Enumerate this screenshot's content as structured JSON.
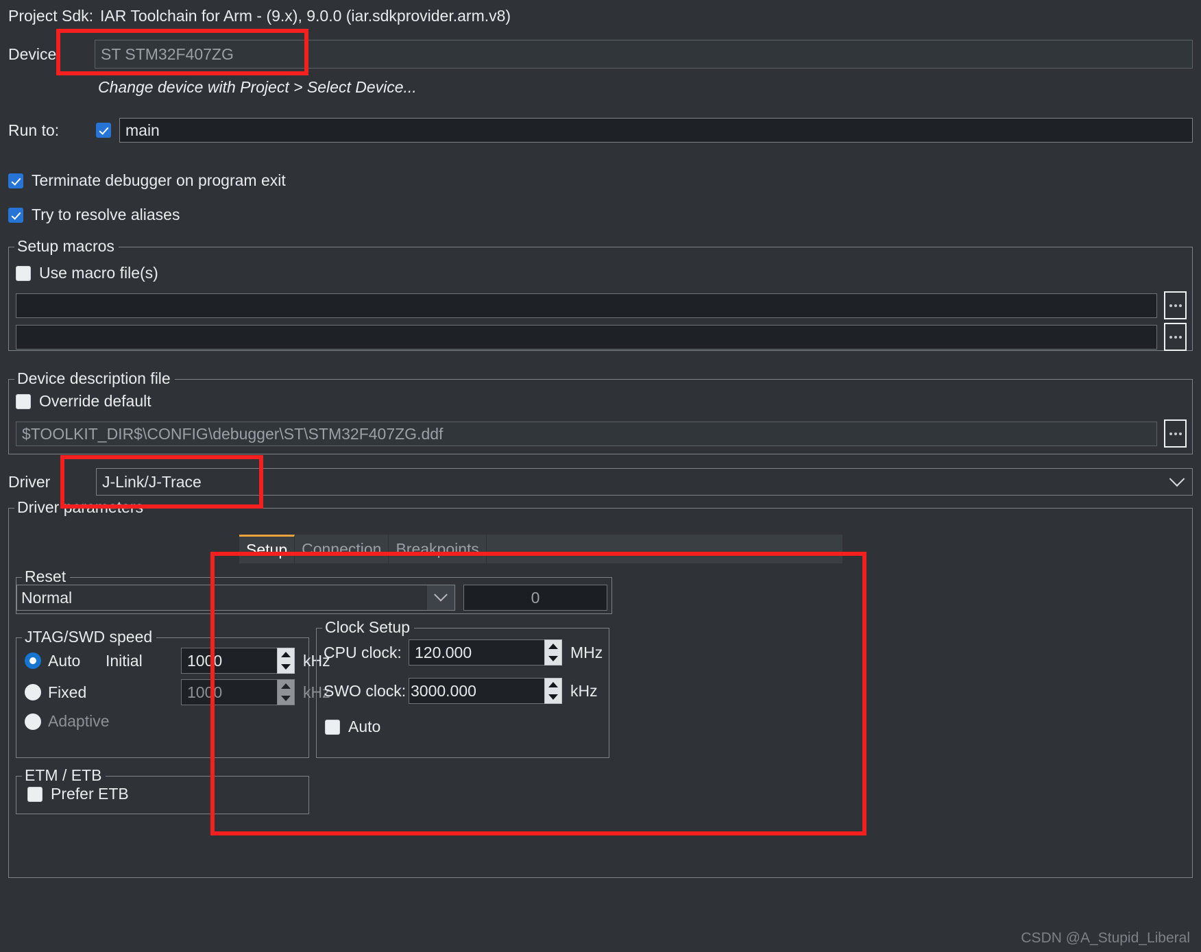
{
  "header": {
    "project_sdk_label": "Project Sdk:",
    "project_sdk_value": "IAR Toolchain for Arm - (9.x), 9.0.0 (iar.sdkprovider.arm.v8)"
  },
  "device": {
    "label": "Device",
    "value": "ST STM32F407ZG",
    "hint": "Change device with Project > Select Device..."
  },
  "run_to": {
    "label": "Run to:",
    "checked": true,
    "value": "main"
  },
  "options": [
    {
      "label": "Terminate debugger on program exit",
      "checked": true
    },
    {
      "label": "Try to resolve aliases",
      "checked": true
    }
  ],
  "setup_macros": {
    "legend": "Setup macros",
    "use_macro_files_label": "Use macro file(s)",
    "use_macro_files_checked": false,
    "file1": "",
    "file2": "",
    "browse_label": "..."
  },
  "device_description_file": {
    "legend": "Device description file",
    "override_default_label": "Override default",
    "override_default_checked": false,
    "path": "$TOOLKIT_DIR$\\CONFIG\\debugger\\ST\\STM32F407ZG.ddf",
    "browse_label": "..."
  },
  "driver": {
    "label": "Driver",
    "value": "J-Link/J-Trace"
  },
  "driver_parameters": {
    "legend": "Driver parameters",
    "tabs": [
      {
        "label": "Setup",
        "active": true
      },
      {
        "label": "Connection",
        "active": false
      },
      {
        "label": "Breakpoints",
        "active": false
      }
    ],
    "reset": {
      "legend": "Reset",
      "selected": "Normal",
      "delay_value": "0"
    },
    "jtag_swd_speed": {
      "legend": "JTAG/SWD speed",
      "auto_label": "Auto",
      "auto_selected": true,
      "initial_label": "Initial",
      "initial_value": "1000",
      "initial_unit": "kHz",
      "fixed_label": "Fixed",
      "fixed_selected": false,
      "fixed_value": "1000",
      "fixed_unit": "kHz",
      "adaptive_label": "Adaptive",
      "adaptive_selected": false,
      "adaptive_disabled": true
    },
    "clock_setup": {
      "legend": "Clock Setup",
      "cpu_clock_label": "CPU clock:",
      "cpu_clock_value": "120.000",
      "cpu_clock_unit": "MHz",
      "swo_clock_label": "SWO clock:",
      "swo_clock_value": "3000.000",
      "swo_clock_unit": "kHz",
      "auto_label": "Auto",
      "auto_checked": false
    },
    "etm_etb": {
      "legend": "ETM / ETB",
      "prefer_etb_label": "Prefer ETB",
      "prefer_etb_checked": false
    }
  },
  "watermark": "CSDN @A_Stupid_Liberal",
  "colors": {
    "background": "#2f3337",
    "accent_checkbox": "#2675d6",
    "tab_active_underline": "#e8a33d",
    "annotation": "#f42020"
  }
}
